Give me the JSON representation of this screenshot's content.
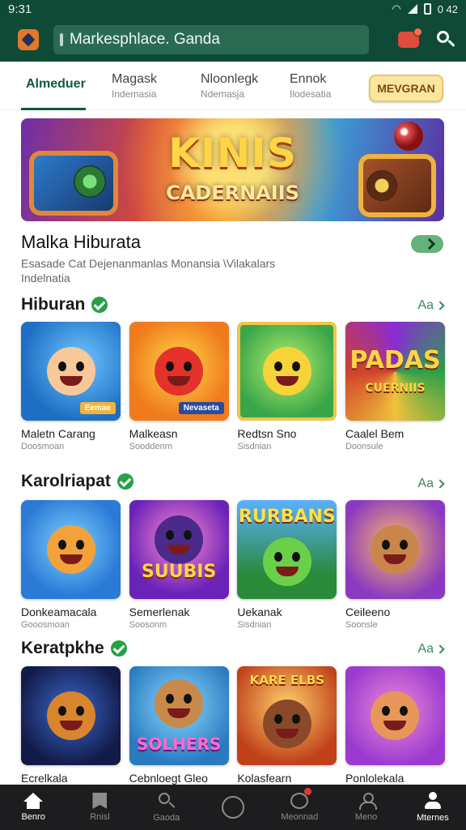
{
  "status": {
    "time": "9:31",
    "battery": "0 42"
  },
  "app_bar": {
    "search_text": "Markesphlace. Ganda"
  },
  "tabs": [
    {
      "label": "Almeduer",
      "sub": ""
    },
    {
      "label": "Magask",
      "sub": "Indemasia"
    },
    {
      "label": "Nloonlegk",
      "sub": "Ndemasja"
    },
    {
      "label": "Ennok",
      "sub": "Ilodesatia"
    }
  ],
  "tab_cta": "MEVGRAN",
  "banner": {
    "title_line1": "KINIS",
    "title_line2": "CADERNAIIS"
  },
  "info": {
    "title": "Malka Hiburata",
    "description_line1": "Esasade Cat Dejenanmanlas Monansia \\Vilakalars",
    "description_line2": "Indelnatia"
  },
  "sections": [
    {
      "title": "Hiburan",
      "see_all": "Aa",
      "games": [
        {
          "name": "Maletn Carang",
          "meta": "Doosmoan",
          "badge": "Eemae"
        },
        {
          "name": "Malkeasn",
          "meta": "Sooddenm",
          "badge": "Nevaseta"
        },
        {
          "name": "Redtsn Sno",
          "meta": "Sisdnian",
          "badge": ""
        },
        {
          "name": "Caalel Bem",
          "meta": "Doonsule",
          "logo1": "PADAS",
          "logo2": "CUERNIIS"
        }
      ]
    },
    {
      "title": "Karolriapat",
      "see_all": "Aa",
      "games": [
        {
          "name": "Donkeamacala",
          "meta": "Gooosmoan",
          "badge": ""
        },
        {
          "name": "Semerlenak",
          "meta": "Soosonm",
          "logo1": "SUUBIS"
        },
        {
          "name": "Uekanak",
          "meta": "Sisdnian",
          "logo1": "RURBANS"
        },
        {
          "name": "Ceileeno",
          "meta": "Soonsle",
          "badge": ""
        }
      ]
    },
    {
      "title": "Keratpkhe",
      "see_all": "Aa",
      "games": [
        {
          "name": "Ecrelkala",
          "meta": ""
        },
        {
          "name": "Cebnloegt Gleo",
          "meta": "",
          "logo1": "SOLHERS"
        },
        {
          "name": "Kolasfearn",
          "meta": "",
          "logo1": "KARE ELBS"
        },
        {
          "name": "Ponlolekala",
          "meta": ""
        }
      ]
    }
  ],
  "bottom_nav": [
    {
      "label": "Benro",
      "icon": "home-icon",
      "active": true
    },
    {
      "label": "Rnisl",
      "icon": "flag-icon"
    },
    {
      "label": "Gaoda",
      "icon": "search-icon"
    },
    {
      "label": "",
      "icon": "gamepad-icon"
    },
    {
      "label": "Meonnad",
      "icon": "chat-icon"
    },
    {
      "label": "Meno",
      "icon": "people-icon"
    },
    {
      "label": "Mternes",
      "icon": "profile-icon"
    }
  ],
  "colors": {
    "header": "#0f4a36",
    "accent": "#27a048",
    "nav_bg": "#1d1d1f"
  }
}
